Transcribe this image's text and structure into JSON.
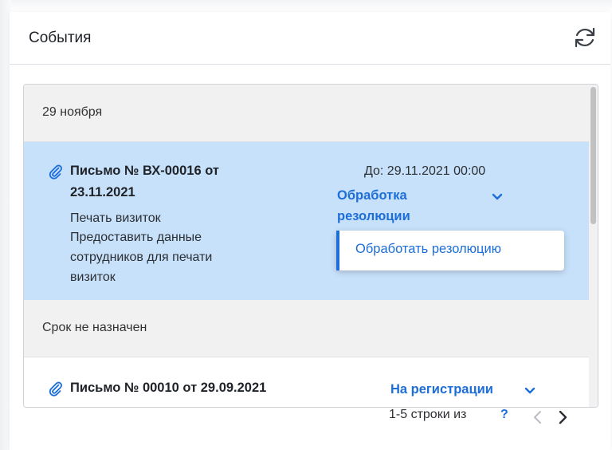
{
  "panel": {
    "title": "События",
    "refresh_icon": "refresh-icon"
  },
  "groups": [
    {
      "date_label": "29 ноября",
      "items": [
        {
          "icon": "paperclip-icon",
          "title_line1": "Письмо № ВХ-00016 от",
          "title_line2": "23.11.2021",
          "text_lines": [
            "Печать визиток",
            "Предоставить данные",
            "сотрудников для печати",
            "визиток"
          ],
          "due": "До: 29.11.2021 00:00",
          "status_line1": "Обработка",
          "status_line2": "резолюции",
          "selected": true
        }
      ]
    },
    {
      "date_label": "Срок не назначен",
      "items": [
        {
          "icon": "paperclip-icon",
          "title": "Письмо № 00010 от 29.09.2021",
          "status": "На регистрации"
        }
      ]
    }
  ],
  "dropdown": {
    "items": [
      "Обработать резолюцию"
    ]
  },
  "pager": {
    "count_text": "1-5 строки из",
    "total": "?",
    "prev_icon": "chevron-left-icon",
    "next_icon": "chevron-right-icon"
  },
  "colors": {
    "accent": "#1d6ed8",
    "selected_row": "#c8e1fb",
    "group_header": "#f1f1f1"
  }
}
